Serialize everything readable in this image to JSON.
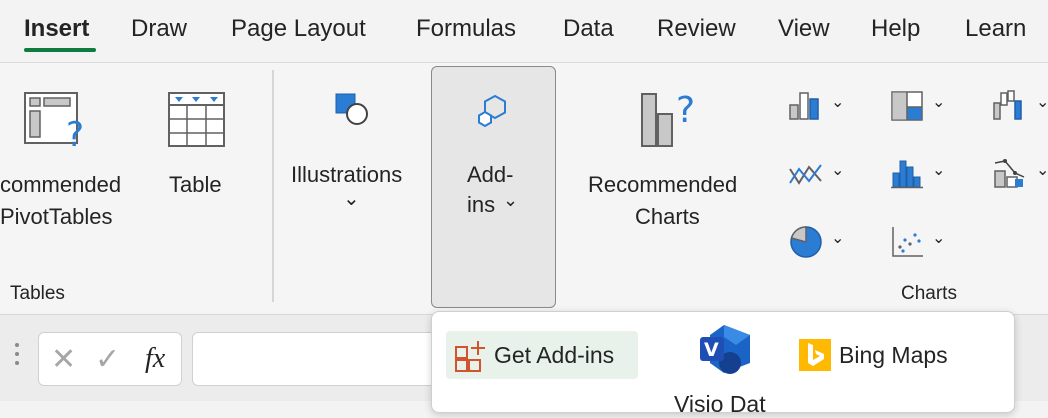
{
  "tabs": [
    {
      "label": "Insert",
      "active": true
    },
    {
      "label": "Draw"
    },
    {
      "label": "Page Layout"
    },
    {
      "label": "Formulas"
    },
    {
      "label": "Data"
    },
    {
      "label": "Review"
    },
    {
      "label": "View"
    },
    {
      "label": "Help"
    },
    {
      "label": "Learn"
    }
  ],
  "ribbon": {
    "recommended_pivottables": {
      "line1": "commended",
      "line2": "PivotTables"
    },
    "table": {
      "label": "Table"
    },
    "illustrations": {
      "label": "Illustrations",
      "chevron": "⌄"
    },
    "addins": {
      "line1": "Add-",
      "line2": "ins",
      "chevron": "⌄"
    },
    "recommended_charts": {
      "line1": "Recommended",
      "line2": "Charts"
    },
    "groups": {
      "tables": "Tables",
      "charts": "Charts"
    },
    "chart_buttons": [
      {
        "name": "column-chart",
        "chevron": "⌄"
      },
      {
        "name": "hierarchy-chart",
        "chevron": "⌄"
      },
      {
        "name": "waterfall-chart",
        "chevron": "⌄"
      },
      {
        "name": "line-chart",
        "chevron": "⌄"
      },
      {
        "name": "statistic-chart",
        "chevron": "⌄"
      },
      {
        "name": "combo-chart",
        "chevron": "⌄"
      },
      {
        "name": "pie-chart",
        "chevron": "⌄"
      },
      {
        "name": "scatter-chart",
        "chevron": "⌄"
      }
    ]
  },
  "formula_bar": {
    "cancel_icon": "✕",
    "enter_icon": "✓",
    "fx_label": "fx"
  },
  "dropdown": {
    "get_addins": "Get Add-ins",
    "visio_label": "Visio Dat",
    "bing_maps": "Bing Maps"
  },
  "colors": {
    "accent_green": "#0f7b3e",
    "icon_blue": "#2b7cd3",
    "bing_yellow": "#ffb900"
  }
}
